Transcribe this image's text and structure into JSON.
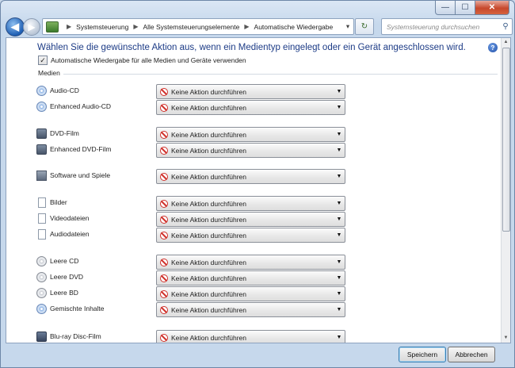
{
  "caption": {
    "minimize": "—",
    "maximize": "☐",
    "close": "✕"
  },
  "nav": {
    "back_glyph": "◀",
    "forward_glyph": "▶",
    "breadcrumbs": [
      "Systemsteuerung",
      "Alle Systemsteuerungselemente",
      "Automatische Wiedergabe"
    ],
    "search_placeholder": "Systemsteuerung durchsuchen"
  },
  "content": {
    "heading": "Wählen Sie die gewünschte Aktion aus, wenn ein Medientyp eingelegt oder ein Gerät angeschlossen wird.",
    "master_checkbox_label": "Automatische Wiedergabe für alle Medien und Geräte verwenden",
    "master_checked": true,
    "group_title": "Medien",
    "rows": [
      {
        "label": "Audio-CD",
        "icon": "audio-cd-icon",
        "action": "Keine Aktion durchführen"
      },
      {
        "label": "Enhanced Audio-CD",
        "icon": "enhanced-audio-cd-icon",
        "action": "Keine Aktion durchführen"
      },
      {
        "label": "DVD-Film",
        "icon": "dvd-film-icon",
        "action": "Keine Aktion durchführen"
      },
      {
        "label": "Enhanced DVD-Film",
        "icon": "enhanced-dvd-film-icon",
        "action": "Keine Aktion durchführen"
      },
      {
        "label": "Software und Spiele",
        "icon": "software-icon",
        "action": "Keine Aktion durchführen"
      },
      {
        "label": "Bilder",
        "icon": "pictures-icon",
        "action": "Keine Aktion durchführen"
      },
      {
        "label": "Videodateien",
        "icon": "video-files-icon",
        "action": "Keine Aktion durchführen"
      },
      {
        "label": "Audiodateien",
        "icon": "audio-files-icon",
        "action": "Keine Aktion durchführen"
      },
      {
        "label": "Leere CD",
        "icon": "blank-cd-icon",
        "action": "Keine Aktion durchführen"
      },
      {
        "label": "Leere DVD",
        "icon": "blank-dvd-icon",
        "action": "Keine Aktion durchführen"
      },
      {
        "label": "Leere BD",
        "icon": "blank-bd-icon",
        "action": "Keine Aktion durchführen"
      },
      {
        "label": "Gemischte Inhalte",
        "icon": "mixed-content-icon",
        "action": "Keine Aktion durchführen"
      },
      {
        "label": "Blu-ray Disc-Film",
        "icon": "bluray-icon",
        "action": "Keine Aktion durchführen"
      }
    ]
  },
  "buttons": {
    "save": "Speichern",
    "cancel": "Abbrechen"
  },
  "colors": {
    "heading": "#1c3b86",
    "no_action_icon": "#d0302a"
  }
}
